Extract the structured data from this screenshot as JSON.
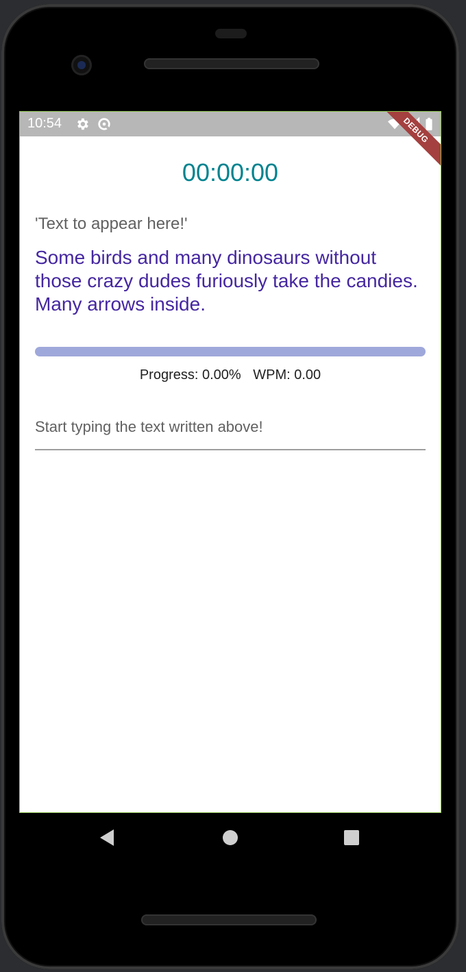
{
  "status_bar": {
    "time": "10:54",
    "icons": [
      "settings-icon",
      "data-saver-icon",
      "wifi-icon",
      "signal-icon",
      "battery-icon"
    ]
  },
  "debug_banner": "DEBUG",
  "timer": "00:00:00",
  "prompt_label": "'Text to appear here!'",
  "target_text": "Some birds and many dinosaurs without those crazy dudes furiously take the candies. Many arrows inside.",
  "progress": {
    "value": 0,
    "label": "Progress: 0.00%",
    "wpm_label": "WPM: 0.00"
  },
  "input": {
    "value": "",
    "placeholder": "Start typing the text written above!"
  },
  "nav": {
    "back": "back-icon",
    "home": "home-icon",
    "recents": "recents-icon"
  },
  "colors": {
    "timer": "#00838f",
    "target_text": "#4527a0",
    "progress_track": "#9fa8da",
    "status_bar": "#b7b7b7",
    "screen_border": "#8bc34a"
  }
}
